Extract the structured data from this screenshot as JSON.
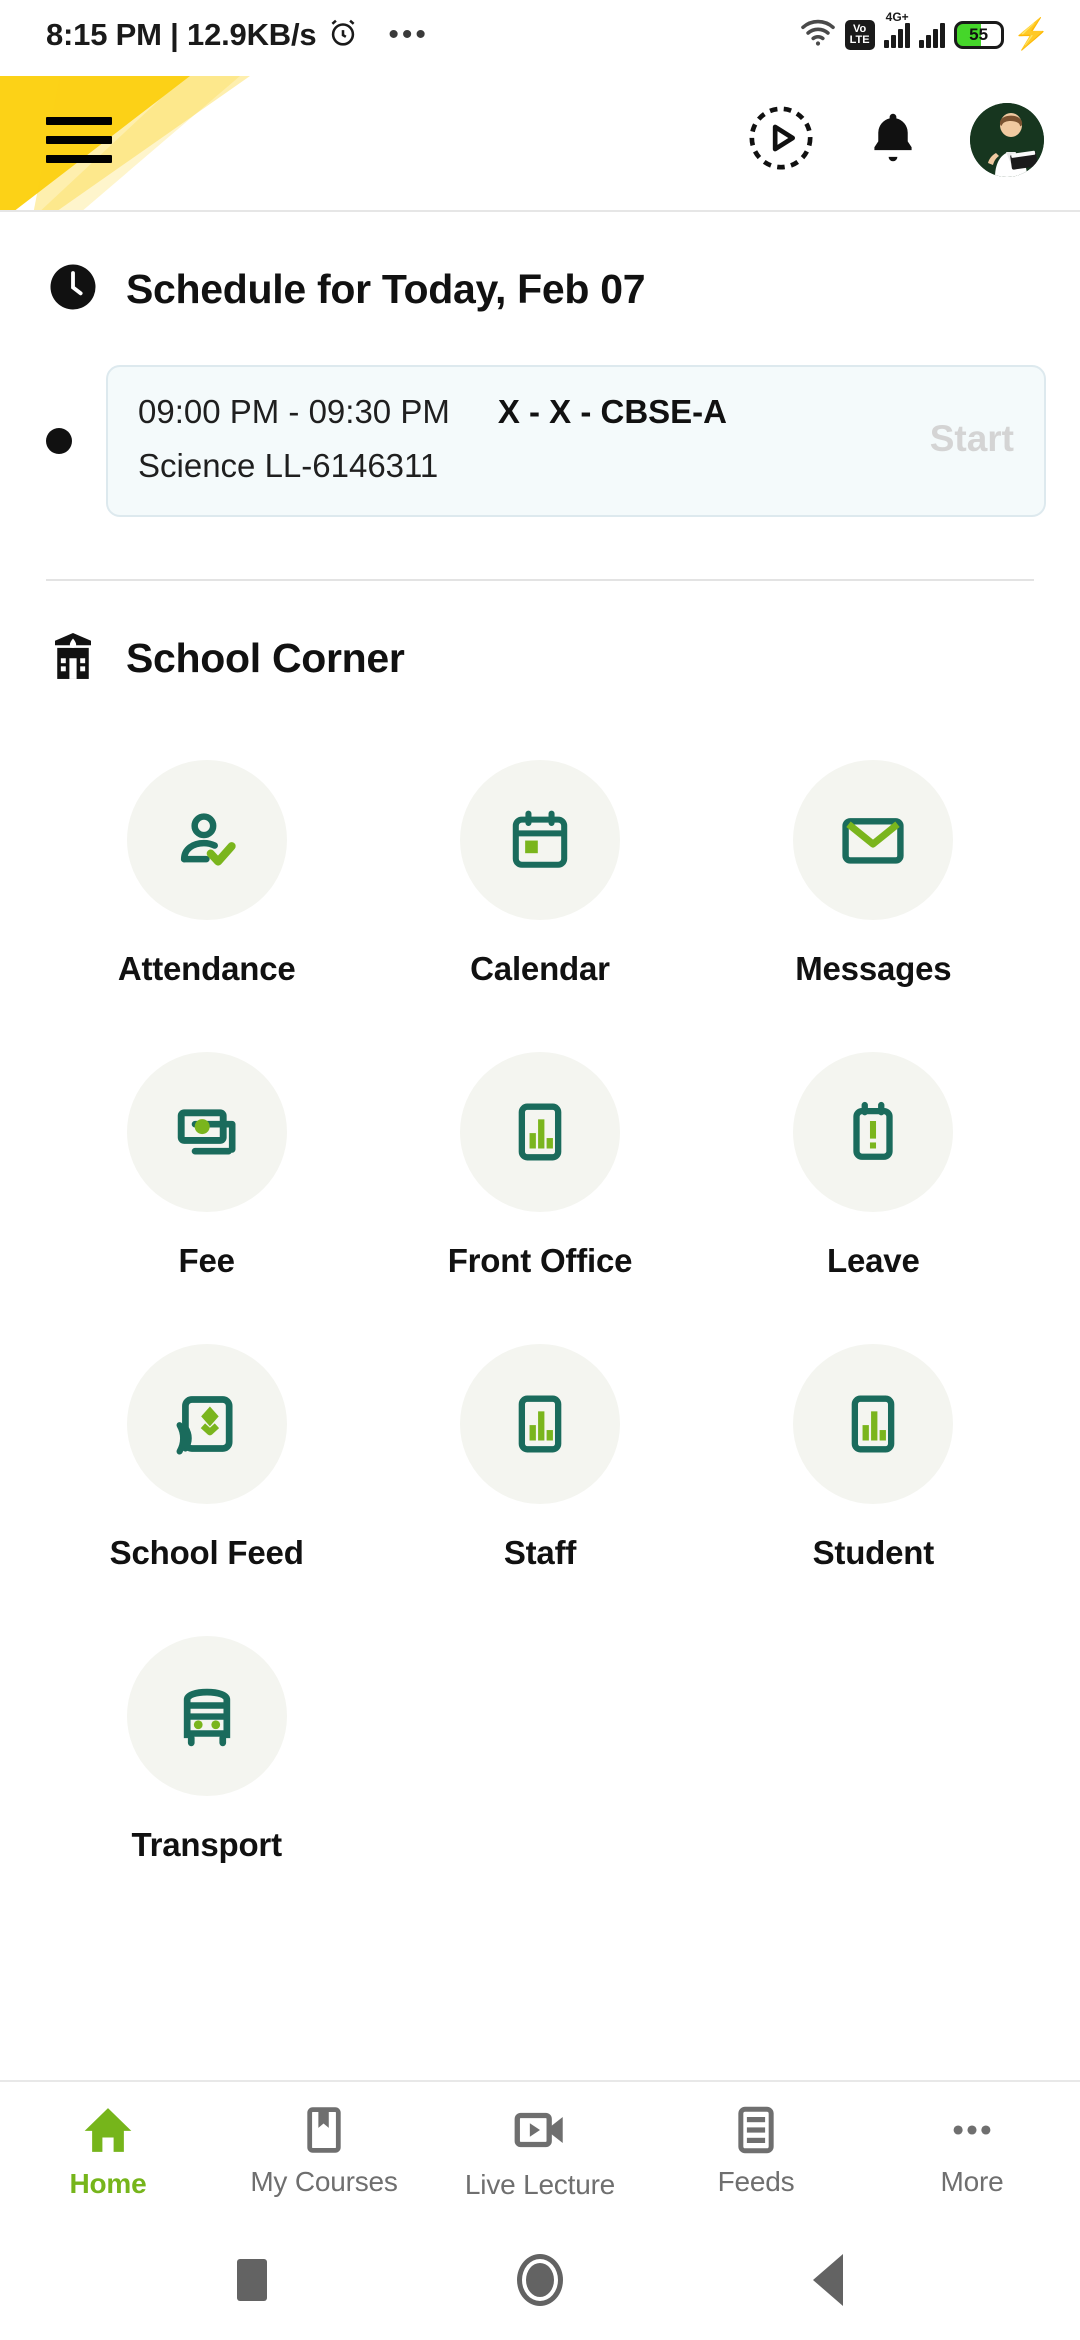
{
  "status_bar": {
    "time_and_speed": "8:15 PM | 12.9KB/s",
    "alarm_icon": "alarm-clock-icon",
    "overflow_icon": "more-dots-icon",
    "wifi_icon": "wifi-icon",
    "volte_top": "Vo",
    "volte_bottom": "LTE",
    "network_type": "4G+",
    "signal_icon": "signal-bars-icon",
    "signal2_icon": "signal-bars-icon",
    "battery_level": "55",
    "charging_icon": "charging-bolt-icon"
  },
  "app_bar": {
    "menu_icon": "hamburger-menu-icon",
    "play_icon": "play-circle-icon",
    "bell_icon": "notification-bell-icon",
    "avatar_icon": "user-avatar-teacher"
  },
  "schedule": {
    "heading": "Schedule for Today, Feb 07",
    "clock_icon": "clock-icon",
    "items": [
      {
        "time": "09:00 PM - 09:30 PM",
        "class": "X - X - CBSE-A",
        "subject": "Science LL-6146311",
        "action_label": "Start"
      }
    ]
  },
  "school_corner": {
    "heading": "School Corner",
    "school_icon": "school-building-icon",
    "tiles": [
      {
        "label": "Attendance",
        "icon": "attendance-person-check-icon"
      },
      {
        "label": "Calendar",
        "icon": "calendar-icon"
      },
      {
        "label": "Messages",
        "icon": "envelope-icon"
      },
      {
        "label": "Fee",
        "icon": "banknote-icon"
      },
      {
        "label": "Front Office",
        "icon": "bar-chart-icon"
      },
      {
        "label": "Leave",
        "icon": "clipboard-alert-icon"
      },
      {
        "label": "School Feed",
        "icon": "broadcast-feed-icon"
      },
      {
        "label": "Staff",
        "icon": "bar-chart-icon"
      },
      {
        "label": "Student",
        "icon": "bar-chart-icon"
      },
      {
        "label": "Transport",
        "icon": "bus-icon"
      }
    ]
  },
  "bottom_nav": {
    "items": [
      {
        "label": "Home",
        "icon": "home-icon",
        "active": true
      },
      {
        "label": "My Courses",
        "icon": "book-bookmark-icon",
        "active": false
      },
      {
        "label": "Live Lecture",
        "icon": "video-camera-icon",
        "active": false
      },
      {
        "label": "Feeds",
        "icon": "feed-list-icon",
        "active": false
      },
      {
        "label": "More",
        "icon": "more-dots-icon",
        "active": false
      }
    ]
  },
  "android_nav": {
    "recents_icon": "recents-square-icon",
    "home_icon": "home-circle-icon",
    "back_icon": "back-triangle-icon"
  },
  "colors": {
    "accent_green": "#76b51b",
    "teal": "#1a6b5c",
    "lime": "#7ab51d",
    "tile_bg": "#f4f5f0",
    "card_bg": "#f4fafb",
    "yellow": "#fcd217"
  }
}
